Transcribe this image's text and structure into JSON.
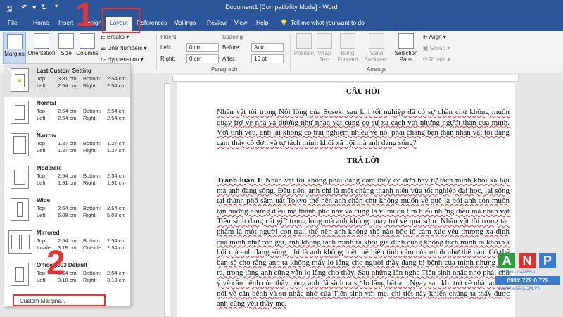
{
  "window": {
    "title": "Document1 [Compatibility Mode] - Word",
    "controls": [
      "save-icon",
      "undo-icon",
      "redo-icon",
      "customize-icon"
    ]
  },
  "tabs": [
    {
      "label": "File",
      "active": false
    },
    {
      "label": "Home",
      "active": false
    },
    {
      "label": "Insert",
      "active": false
    },
    {
      "label": "Design",
      "active": false
    },
    {
      "label": "Layout",
      "active": true
    },
    {
      "label": "References",
      "active": false
    },
    {
      "label": "Mailings",
      "active": false
    },
    {
      "label": "Review",
      "active": false
    },
    {
      "label": "View",
      "active": false
    },
    {
      "label": "Help",
      "active": false
    }
  ],
  "tell_me": "Tell me what you want to do",
  "ribbon": {
    "page_setup": {
      "margins": "Margins",
      "orientation": "Orientation",
      "size": "Size",
      "columns": "Columns",
      "breaks": "Breaks",
      "line_numbers": "Line Numbers",
      "hyphenation": "Hyphenation"
    },
    "paragraph": {
      "label": "Paragraph",
      "indent": "Indent",
      "spacing": "Spacing",
      "left_label": "Left:",
      "left_value": "0 cm",
      "right_label": "Right:",
      "right_value": "0 cm",
      "before_label": "Before:",
      "before_value": "Auto",
      "after_label": "After:",
      "after_value": "10 pt"
    },
    "arrange": {
      "label": "Arrange",
      "position": "Position",
      "wrap_text": "Wrap Text",
      "bring_forward": "Bring Forward",
      "send_backward": "Send Backward",
      "selection_pane": "Selection Pane",
      "align": "Align",
      "group": "Group",
      "rotate": "Rotate"
    }
  },
  "margins_menu": {
    "items": [
      {
        "name": "Last Custom Setting",
        "top": "3.81 cm",
        "bottom": "2.54 cm",
        "left": "2.54 cm",
        "right": "2.54 cm",
        "k1": "Top:",
        "k2": "Bottom:",
        "k3": "Left:",
        "k4": "Right:"
      },
      {
        "name": "Normal",
        "top": "2.54 cm",
        "bottom": "2.54 cm",
        "left": "2.54 cm",
        "right": "2.54 cm",
        "k1": "Top:",
        "k2": "Bottom:",
        "k3": "Left:",
        "k4": "Right:"
      },
      {
        "name": "Narrow",
        "top": "1.27 cm",
        "bottom": "1.27 cm",
        "left": "1.27 cm",
        "right": "1.27 cm",
        "k1": "Top:",
        "k2": "Bottom:",
        "k3": "Left:",
        "k4": "Right:"
      },
      {
        "name": "Moderate",
        "top": "2.54 cm",
        "bottom": "2.54 cm",
        "left": "1.91 cm",
        "right": "1.91 cm",
        "k1": "Top:",
        "k2": "Bottom:",
        "k3": "Left:",
        "k4": "Right:"
      },
      {
        "name": "Wide",
        "top": "2.54 cm",
        "bottom": "2.54 cm",
        "left": "5.08 cm",
        "right": "5.08 cm",
        "k1": "Top:",
        "k2": "Bottom:",
        "k3": "Left:",
        "k4": "Right:"
      },
      {
        "name": "Mirrored",
        "top": "2.54 cm",
        "bottom": "2.54 cm",
        "left": "3.18 cm",
        "right": "2.54 cm",
        "k1": "Top:",
        "k2": "Bottom:",
        "k3": "Inside:",
        "k4": "Outside:"
      },
      {
        "name": "Office 2003 Default",
        "top": "2.54 cm",
        "bottom": "2.54 cm",
        "left": "3.18 cm",
        "right": "3.18 cm",
        "k1": "Top:",
        "k2": "Bottom:",
        "k3": "Left:",
        "k4": "Right:"
      }
    ],
    "custom_margins": "Custom Margins..."
  },
  "annotations": {
    "step1": "1",
    "step2": "2",
    "color": "#e53535"
  },
  "document": {
    "heading1": "CÂU HỎI",
    "question": "Nhân vật tôi trong Nỗi lòng của Soseki sau khi tốt nghiệp đã có sự chần chừ không muốn quay trở về nhà và dường như nhân vật cũng có sự xa cách với những người thân của mình. Với tình yêu, anh lại không có trải nghiệm nhiều về nó, phải chăng bạn thân nhân vật tôi đang cảm thấy cô đơn và tự tách mình khỏi xã hội mà anh đang sống?",
    "heading2": "TRẢ LỜI",
    "answer_label": "Tranh luận 1",
    "answer": ": Nhân vật tôi không phải đang cảm thấy cô đơn hay tự tách mình khỏi xã hội mà anh đang sống. Đầu tiên, anh chỉ là một chàng thanh niên vừa tốt nghiệp đại học, lại sống tại thành phố sầm uất Tokyo thế nên anh chần chừ không muốn về quê là bởi anh còn muốn tận hưởng những điều mà thành phố này và cũng là vì muốn tìm hiểu những điều mà nhân vật Tiên sinh đang cất giữ trong lòng mà anh không quay trở về quá sớm. Nhân vật tôi trong tác phẩm là một người con trai, thế nên anh không thể nào bộc lộ cảm xúc yêu thương xa đình của mình như con gái, anh không tách mình ra khỏi gia đình cũng không tách mình ra khỏi xã hội mà anh đang sống, chỉ là anh không biết thể hiện tình cảm của mình như thế nào. Có thể bạn sẽ cho rằng anh ta không mấy lo lắng cho người thầy đang bị bệnh của mình nhưng thật ra, trong lòng anh cũng vẫn lo lắng cho thầy. Sau những lần nghe Tiên sinh nhắc nhở phải chú ý về căn bệnh của thầy, lòng anh đã sinh ra sự lo lắng bất an. Ngay sau khi trở về nhà, anh đã nói về căn bệnh và sự nhắc nhở của Tiên sinh với mẹ, chi tiết này khiến chúng ta thấy được anh cũng yêu thầy mẹ."
  },
  "watermark": {
    "letters": [
      "A",
      "N",
      "P"
    ],
    "tagline": "VI TÍNH - CAMERA",
    "phone": "0912 772 0 772",
    "web": "WWW.ANP.COM.VN",
    "colors": {
      "a": "#2f9e44",
      "n": "#e03131",
      "p": "#3a7bd5"
    }
  }
}
